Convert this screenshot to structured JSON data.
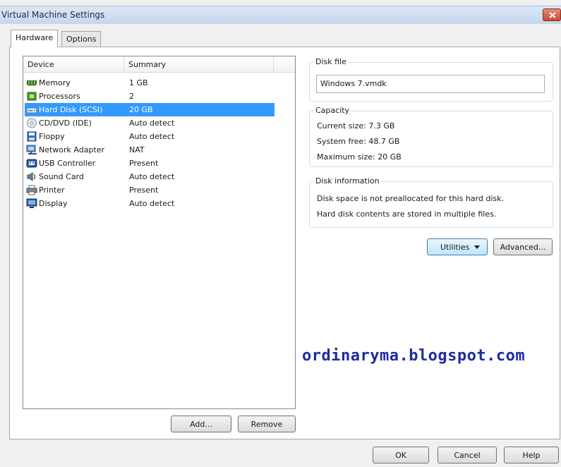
{
  "window": {
    "title": "Virtual Machine Settings"
  },
  "tabs": [
    {
      "label": "Hardware",
      "active": true
    },
    {
      "label": "Options",
      "active": false
    }
  ],
  "device_list": {
    "columns": [
      "Device",
      "Summary"
    ],
    "rows": [
      {
        "device": "Memory",
        "summary": "1 GB",
        "icon": "memory-icon",
        "selected": false
      },
      {
        "device": "Processors",
        "summary": "2",
        "icon": "processor-icon",
        "selected": false
      },
      {
        "device": "Hard Disk (SCSI)",
        "summary": "20 GB",
        "icon": "hard-disk-icon",
        "selected": true
      },
      {
        "device": "CD/DVD (IDE)",
        "summary": "Auto detect",
        "icon": "cd-dvd-icon",
        "selected": false
      },
      {
        "device": "Floppy",
        "summary": "Auto detect",
        "icon": "floppy-icon",
        "selected": false
      },
      {
        "device": "Network Adapter",
        "summary": "NAT",
        "icon": "network-adapter-icon",
        "selected": false
      },
      {
        "device": "USB Controller",
        "summary": "Present",
        "icon": "usb-icon",
        "selected": false
      },
      {
        "device": "Sound Card",
        "summary": "Auto detect",
        "icon": "sound-card-icon",
        "selected": false
      },
      {
        "device": "Printer",
        "summary": "Present",
        "icon": "printer-icon",
        "selected": false
      },
      {
        "device": "Display",
        "summary": "Auto detect",
        "icon": "display-icon",
        "selected": false
      }
    ]
  },
  "list_buttons": {
    "add": "Add...",
    "remove": "Remove"
  },
  "disk_file": {
    "title": "Disk file",
    "value": "Windows 7.vmdk"
  },
  "capacity": {
    "title": "Capacity",
    "current_size": "Current size: 7.3 GB",
    "system_free": "System free: 48.7 GB",
    "maximum_size": "Maximum size: 20 GB"
  },
  "disk_information": {
    "title": "Disk information",
    "line1": "Disk space is not preallocated for this hard disk.",
    "line2": "Hard disk contents are stored in multiple files."
  },
  "disk_buttons": {
    "utilities": "Utilities",
    "advanced": "Advanced..."
  },
  "watermark": "ordinaryma.blogspot.com",
  "footer": {
    "ok": "OK",
    "cancel": "Cancel",
    "help": "Help"
  },
  "colors": {
    "selection": "#3399ff",
    "watermark": "#1d2ca3"
  }
}
